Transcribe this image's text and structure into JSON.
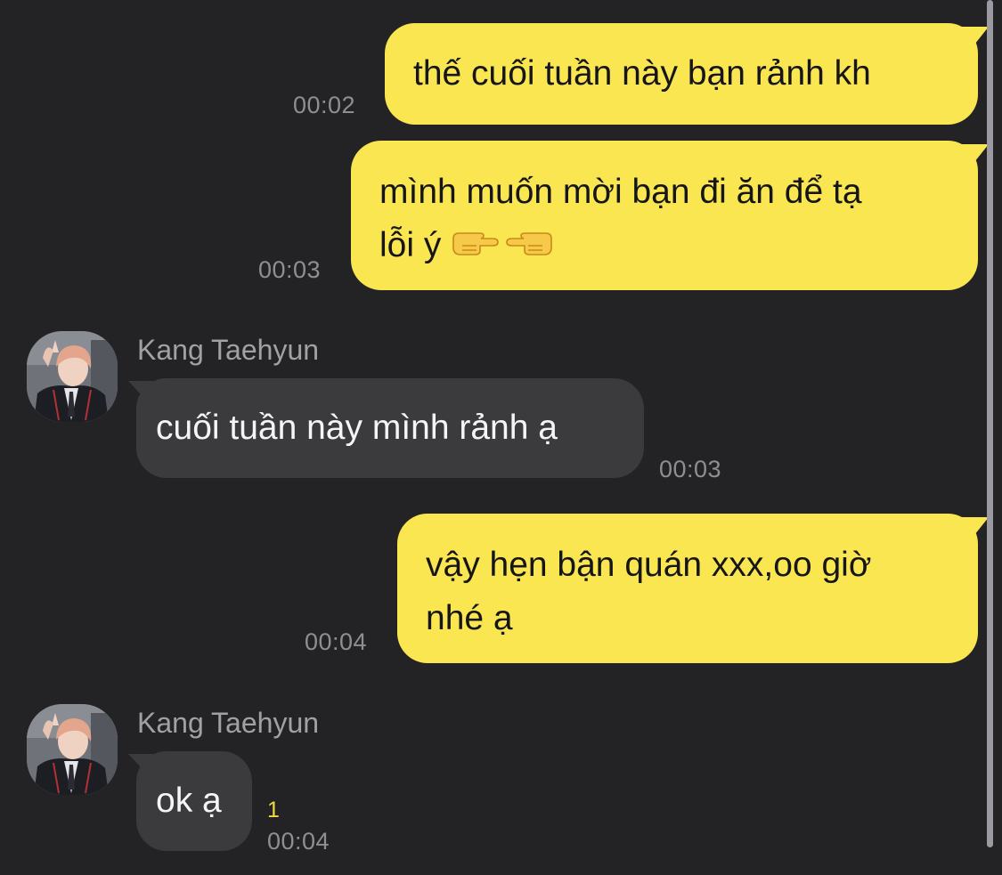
{
  "conversation": {
    "messages": [
      {
        "direction": "outgoing",
        "lines": [
          "thế cuối tuần này bạn rảnh kh"
        ],
        "time": "00:02"
      },
      {
        "direction": "outgoing",
        "lines": [
          "mình muốn mời bạn đi ăn để tạ",
          "lỗi ý"
        ],
        "emoji": [
          "backhand-index-pointing-right",
          "backhand-index-pointing-left"
        ],
        "time": "00:03"
      },
      {
        "direction": "incoming",
        "sender": "Kang Taehyun",
        "lines": [
          "cuối tuần này mình rảnh ạ"
        ],
        "time": "00:03"
      },
      {
        "direction": "outgoing",
        "lines": [
          "vậy hẹn bận quán xxx,oo giờ",
          "nhé ạ"
        ],
        "time": "00:04"
      },
      {
        "direction": "incoming",
        "sender": "Kang Taehyun",
        "lines": [
          "ok ạ"
        ],
        "unread_count": "1",
        "time": "00:04"
      }
    ]
  },
  "colors": {
    "background": "#232325",
    "outgoing_bubble": "#fae650",
    "incoming_bubble": "#3b3b3e",
    "timestamp": "#8f8f93",
    "unread_badge": "#f3d93c"
  },
  "icons": {
    "avatar": "profile-photo",
    "emoji": "pointing-hand-emoji"
  }
}
